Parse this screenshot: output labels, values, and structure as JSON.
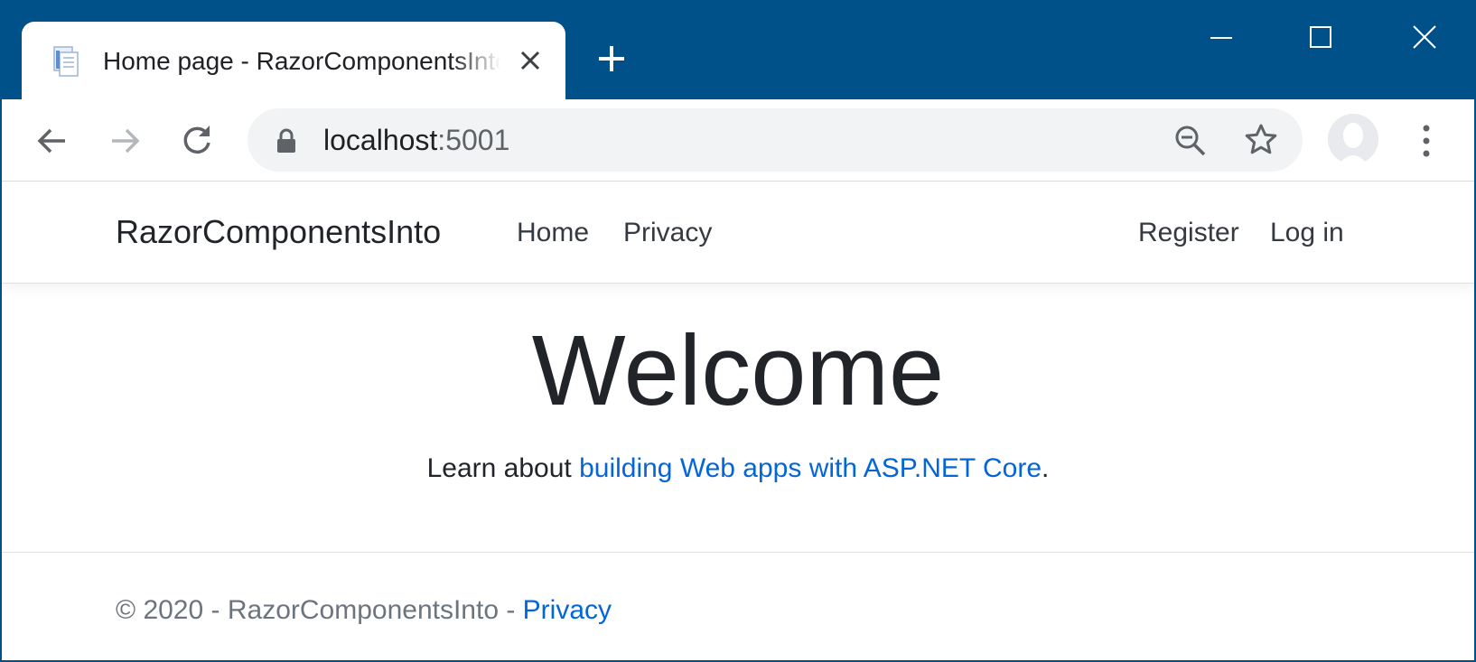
{
  "browser": {
    "tab_title": "Home page - RazorComponentsInto",
    "address": {
      "host": "localhost",
      "port": ":5001"
    },
    "colors": {
      "frame": "#00518a",
      "omnibox": "#f1f3f4"
    }
  },
  "site": {
    "brand": "RazorComponentsInto",
    "nav_left": [
      "Home",
      "Privacy"
    ],
    "nav_right": [
      "Register",
      "Log in"
    ]
  },
  "main": {
    "heading": "Welcome",
    "lead_prefix": "Learn about ",
    "lead_link": "building Web apps with ASP.NET Core",
    "lead_suffix": "."
  },
  "footer": {
    "text": "© 2020 - RazorComponentsInto - ",
    "link": "Privacy"
  },
  "colors": {
    "link": "#0366d6",
    "text": "#212529",
    "muted": "#6c757d"
  }
}
